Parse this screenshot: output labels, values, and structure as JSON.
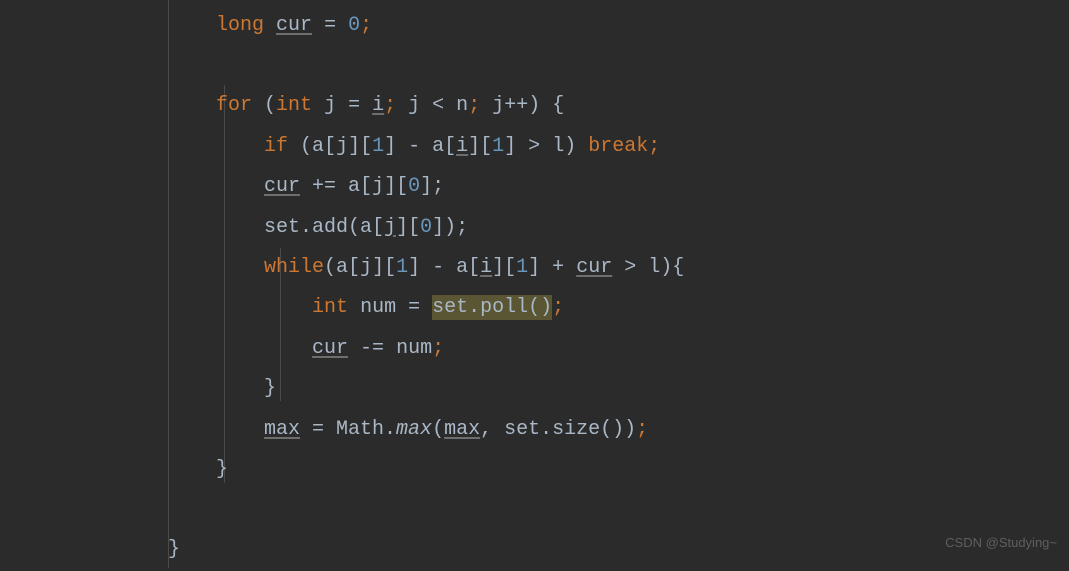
{
  "code": {
    "kw_long": "long",
    "cur": "cur",
    "eq": " = ",
    "zero": "0",
    "semi": ";",
    "kw_for": "for",
    "sp_lp": " (",
    "kw_int": "int",
    "j": "j",
    "i": "i",
    "lt": " < ",
    "n": "n",
    "semi_sp": "; ",
    "inc": "++) {",
    "kw_if": "if",
    "lp": " (",
    "a_lb": "a[",
    "rb_lb": "][",
    "one": "1",
    "close_minus": "] - a[",
    "close_gt": "] > ",
    "l": "l",
    "rp_sp": ") ",
    "kw_break": "break",
    "peq": " += a[",
    "close0": "][",
    "zero2": "0",
    "rb_semi": "];",
    "set_add": "set.add(a[",
    "rb_rb_rp": "]);",
    "kw_while": "while",
    "close_plus": "] + ",
    "gt_sp": " > ",
    "rp_lb": "){",
    "num_ident": "num",
    "set_poll": "set.poll()",
    "meq": " -= ",
    "close_brace": "}",
    "max": "max",
    "math": " = Math.",
    "max_call": "max",
    "lp2": "(",
    "comma_sp": ", ",
    "set_size": "set.size())",
    "outer_close": "}"
  },
  "watermark": "CSDN @Studying~"
}
